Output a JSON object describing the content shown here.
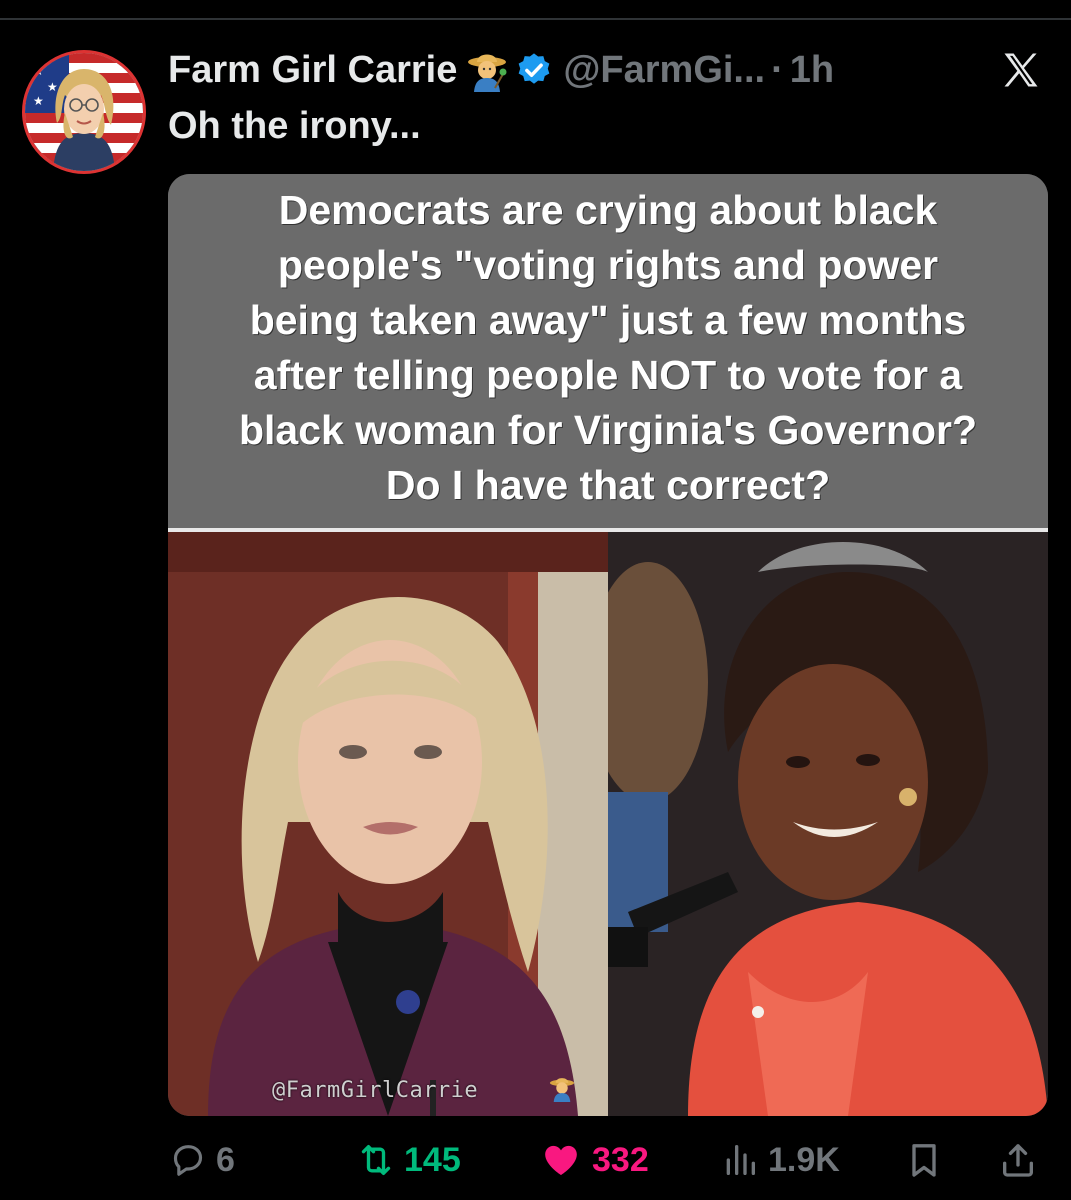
{
  "post": {
    "author_name": "Farm Girl Carrie",
    "handle": "@FarmGi...",
    "separator": "·",
    "time": "1h",
    "text": "Oh the irony..."
  },
  "meme": {
    "text": "Democrats are crying about black\npeople's \"voting rights and power\nbeing taken away\" just a few months\nafter telling people NOT to vote for a\nblack woman for Virginia's Governor?\nDo I have that correct?",
    "watermark": "@FarmGirlCarrie"
  },
  "actions": {
    "replies": "6",
    "reposts": "145",
    "likes": "332",
    "views": "1.9K"
  },
  "colors": {
    "background": "#000000",
    "text": "#e7e9ea",
    "muted": "#71767b",
    "verified": "#1d9bf0",
    "repost": "#00ba7c",
    "like": "#f91880",
    "meme_banner": "#6b6b6b"
  },
  "icons": [
    "farmer-emoji-icon",
    "verified-badge-icon",
    "x-logo-icon",
    "reply-icon",
    "repost-icon",
    "like-icon",
    "views-icon",
    "bookmark-icon",
    "share-icon"
  ]
}
